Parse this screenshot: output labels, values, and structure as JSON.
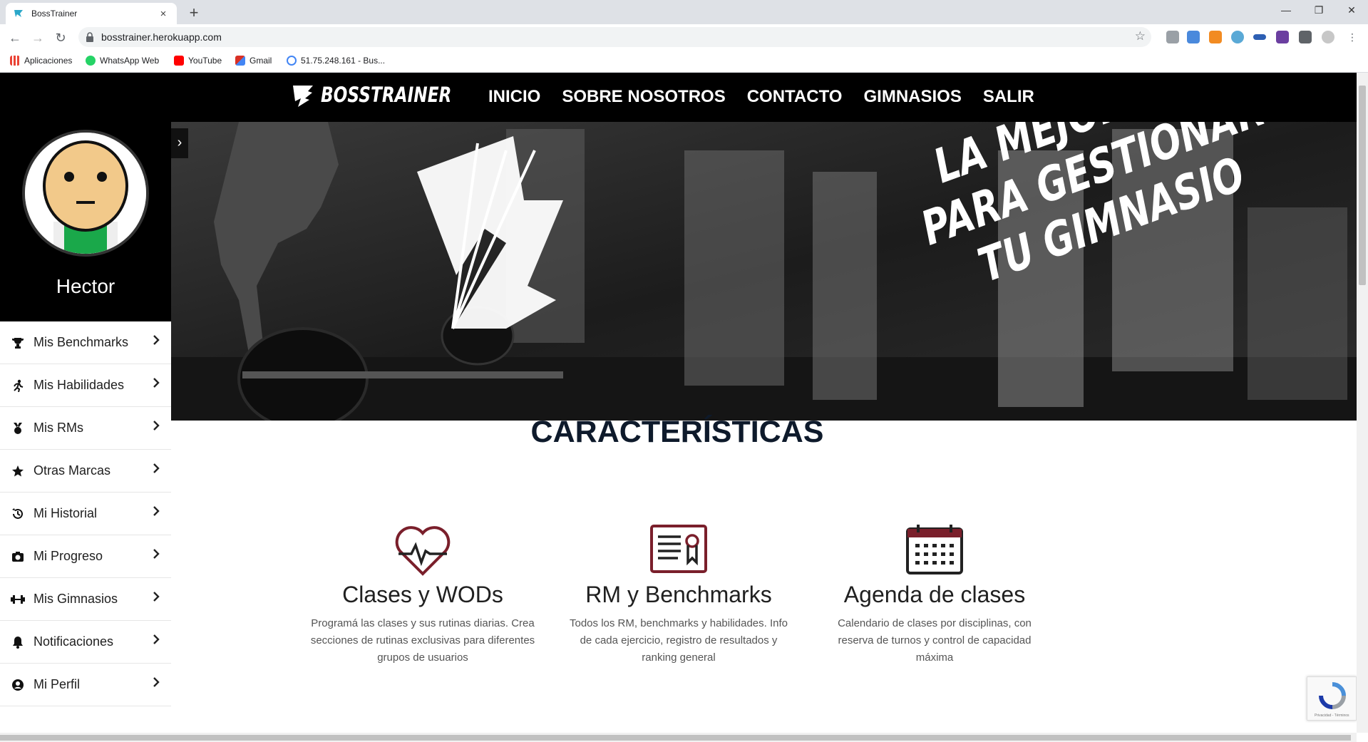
{
  "browser": {
    "tab_title": "BossTrainer",
    "close_tab": "×",
    "new_tab": "+",
    "url": "bosstrainer.herokuapp.com",
    "bookmarks": [
      {
        "label": "Aplicaciones",
        "icon": "apps-grid-icon",
        "color": "#ea4335"
      },
      {
        "label": "WhatsApp Web",
        "icon": "whatsapp-icon",
        "color": "#25d366"
      },
      {
        "label": "YouTube",
        "icon": "youtube-icon",
        "color": "#ff0000"
      },
      {
        "label": "Gmail",
        "icon": "gmail-icon",
        "color": "#d93025"
      },
      {
        "label": "51.75.248.161 - Bus...",
        "icon": "google-icon",
        "color": "#4285f4"
      }
    ]
  },
  "site": {
    "brand": "BOSSTRAINER",
    "nav": [
      "INICIO",
      "SOBRE NOSOTROS",
      "CONTACTO",
      "GIMNASIOS",
      "SALIR"
    ],
    "user_name": "Hector",
    "sidebar": [
      {
        "label": "Mis Benchmarks",
        "icon": "trophy-icon"
      },
      {
        "label": "Mis Habilidades",
        "icon": "running-icon"
      },
      {
        "label": "Mis RMs",
        "icon": "medal-icon"
      },
      {
        "label": "Otras Marcas",
        "icon": "star-icon"
      },
      {
        "label": "Mi Historial",
        "icon": "history-icon"
      },
      {
        "label": "Mi Progreso",
        "icon": "camera-icon"
      },
      {
        "label": "Mis Gimnasios",
        "icon": "dumbbell-icon"
      },
      {
        "label": "Notificaciones",
        "icon": "bell-icon"
      },
      {
        "label": "Mi Perfil",
        "icon": "user-circle-icon"
      }
    ],
    "hero_lines": [
      "LA MEJOR APP",
      "PARA GESTIONAR",
      "TU GIMNASIO"
    ],
    "section_title": "CARACTERÍSTICAS",
    "features": [
      {
        "title": "Clases y WODs",
        "text": "Programá las clases y sus rutinas diarias. Crea secciones de rutinas exclusivas para diferentes grupos de usuarios",
        "icon": "heart-pulse-icon"
      },
      {
        "title": "RM y Benchmarks",
        "text": "Todos los RM, benchmarks y habilidades. Info de cada ejercicio, registro de resultados y ranking general",
        "icon": "certificate-icon"
      },
      {
        "title": "Agenda de clases",
        "text": "Calendario de clases por disciplinas, con reserva de turnos y control de capacidad máxima",
        "icon": "calendar-icon"
      }
    ],
    "recaptcha_label": "Privacidad - Términos",
    "accent_color": "#7a1f2b"
  }
}
